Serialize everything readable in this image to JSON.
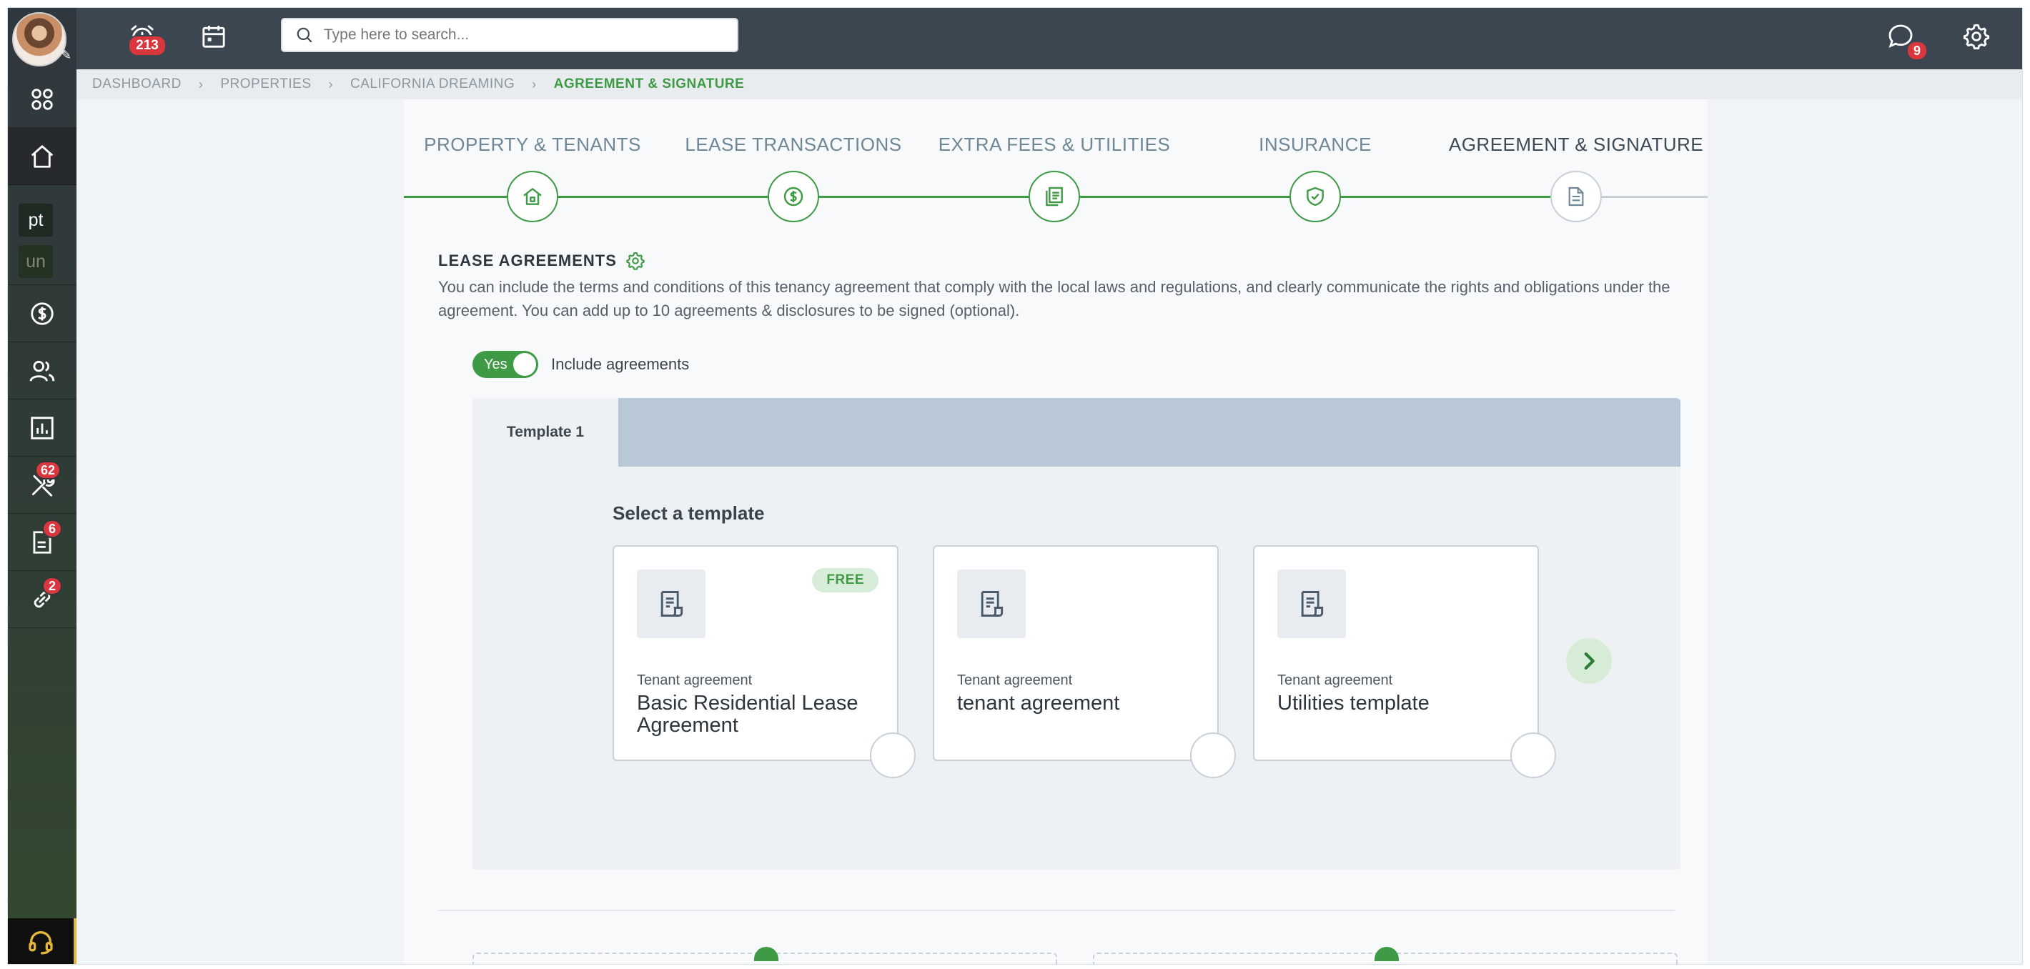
{
  "colors": {
    "accent_green": "#3e9a44",
    "header_bg": "#3b4650",
    "badge_red": "#d9363e",
    "tab_strip": "#b9c8d7"
  },
  "header": {
    "alarm_badge": "213",
    "search_placeholder": "Type here to search...",
    "chat_badge": "9",
    "icons": [
      "alarm-clock-icon",
      "calendar-icon",
      "search-icon",
      "chat-bubble-icon",
      "gear-icon"
    ]
  },
  "sidebar": {
    "tag_pt": "pt",
    "tag_un": "un",
    "maintenance_badge": "62",
    "documents_badge": "6",
    "links_badge": "2",
    "icons": [
      "apps-grid-icon",
      "home-icon",
      "dollar-circle-icon",
      "users-icon",
      "bar-chart-icon",
      "tools-icon",
      "document-icon",
      "link-icon",
      "headset-icon"
    ]
  },
  "breadcrumb": {
    "items": [
      "DASHBOARD",
      "PROPERTIES",
      "CALIFORNIA DREAMING"
    ],
    "current": "AGREEMENT & SIGNATURE"
  },
  "stepper": {
    "steps": [
      {
        "label": "PROPERTY & TENANTS",
        "icon": "house-icon"
      },
      {
        "label": "LEASE TRANSACTIONS",
        "icon": "dollar-circle-icon"
      },
      {
        "label": "EXTRA FEES & UTILITIES",
        "icon": "documents-icon"
      },
      {
        "label": "INSURANCE",
        "icon": "shield-check-icon"
      },
      {
        "label": "AGREEMENT & SIGNATURE",
        "icon": "document-icon"
      }
    ],
    "current_index": 4
  },
  "lease": {
    "title": "LEASE AGREEMENTS",
    "description": "You can include the terms and conditions of this tenancy agreement that comply with the local laws and regulations, and clearly communicate the rights and obligations under the agreement. You can add up to 10 agreements & disclosures to be signed (optional).",
    "toggle_label": "Yes",
    "toggle_on": true,
    "include_label": "Include agreements"
  },
  "templates": {
    "tab_label": "Template 1",
    "select_title": "Select a template",
    "cards": [
      {
        "category": "Tenant agreement",
        "name": "Basic Residential Lease Agreement",
        "badge": "FREE"
      },
      {
        "category": "Tenant agreement",
        "name": "tenant agreement",
        "badge": ""
      },
      {
        "category": "Tenant agreement",
        "name": "Utilities template",
        "badge": ""
      }
    ]
  }
}
